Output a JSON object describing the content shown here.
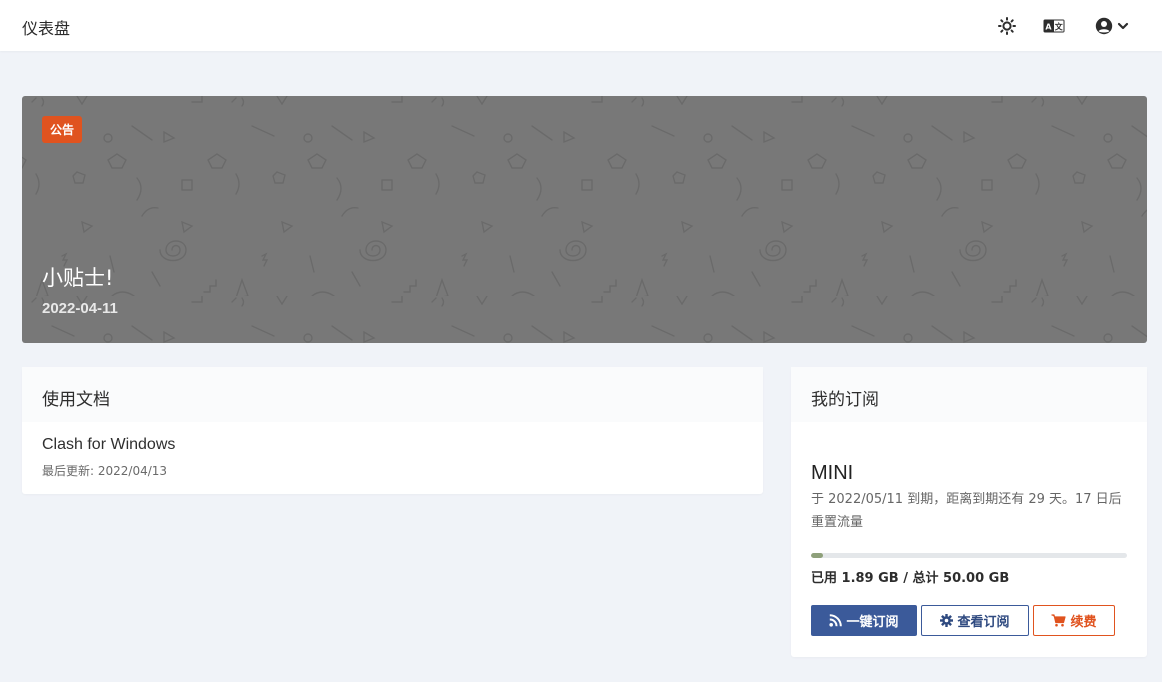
{
  "header": {
    "title": "仪表盘",
    "icons": [
      "theme-toggle-icon",
      "language-icon",
      "user-circle-icon",
      "chevron-down-icon"
    ]
  },
  "notice": {
    "badge": "公告",
    "title": "小贴士!",
    "date": "2022-04-11"
  },
  "docs": {
    "heading": "使用文档",
    "items": [
      {
        "name": "Clash for Windows",
        "updated": "最后更新: 2022/04/13"
      }
    ]
  },
  "subscription": {
    "heading": "我的订阅",
    "plan": "MINI",
    "expiry_text": "于 2022/05/11 到期，距离到期还有 29 天。17 日后重置流量",
    "usage_text": "已用 1.89 GB / 总计 50.00 GB",
    "used_fraction": 0.0378,
    "buttons": {
      "subscribe": "一键订阅",
      "view": "查看订阅",
      "renew": "续费"
    }
  },
  "colors": {
    "accent": "#3b5a9a",
    "warning": "#e0531f",
    "banner_bg": "#787878",
    "progress_fill": "#8ea07a"
  }
}
